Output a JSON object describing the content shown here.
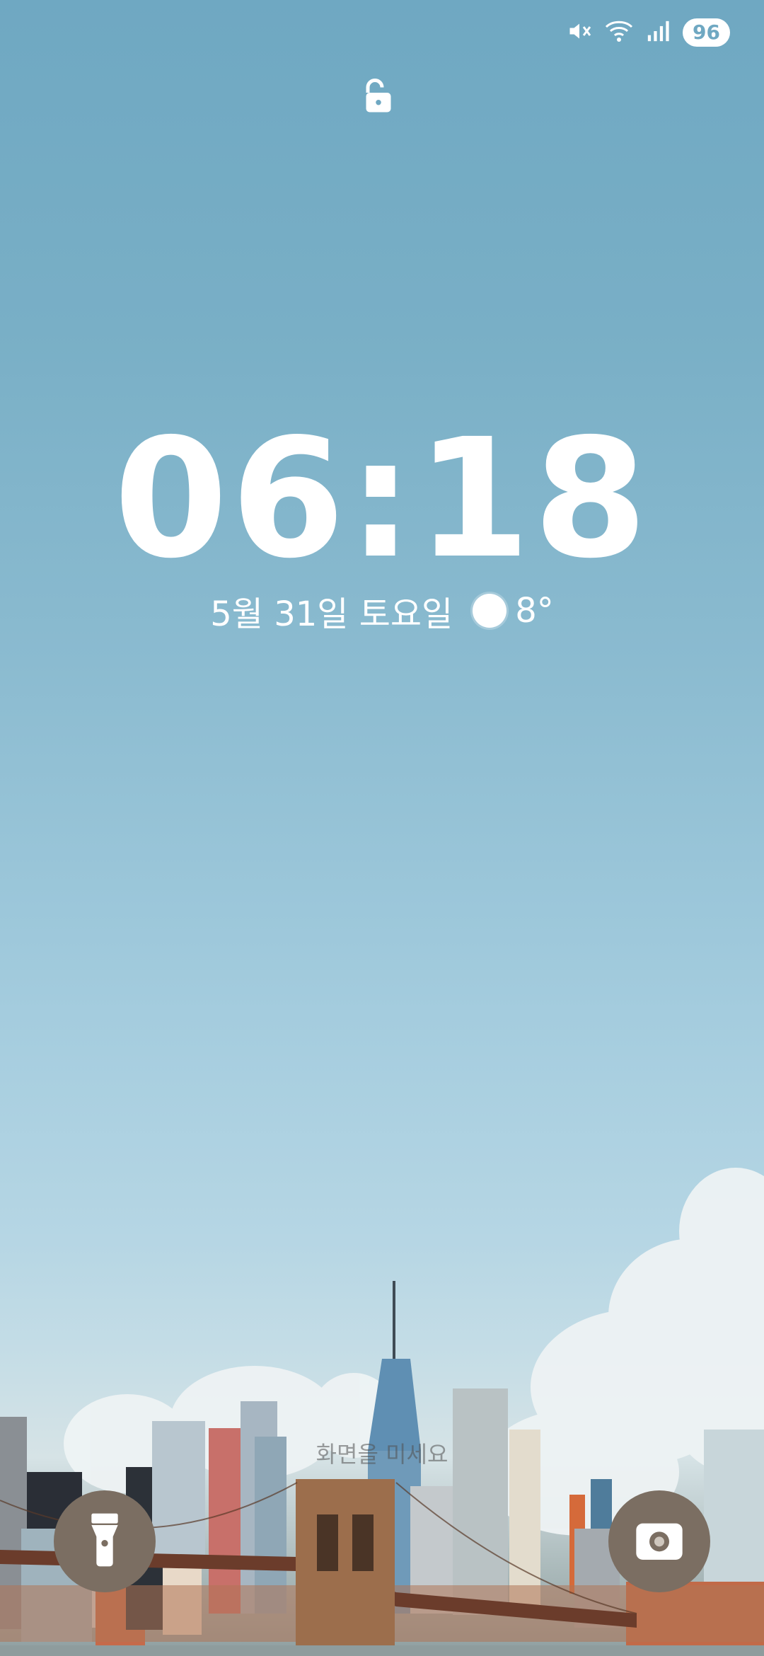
{
  "status_bar": {
    "icons": [
      "mute-icon",
      "wifi-icon",
      "signal-icon"
    ],
    "battery": "96"
  },
  "lock_screen": {
    "lock_icon": "unlocked-padlock-icon",
    "time": "06:18",
    "date": "5월 31일 토요일",
    "weather_icon": "sun-icon",
    "temperature": "8°",
    "hint": "화면을 미세요"
  },
  "shortcuts": {
    "left": "flashlight-icon",
    "right": "camera-icon"
  },
  "colors": {
    "sky_top": "#6fa8c2",
    "shortcut_bg": "#7b6e62",
    "text": "#ffffff"
  }
}
